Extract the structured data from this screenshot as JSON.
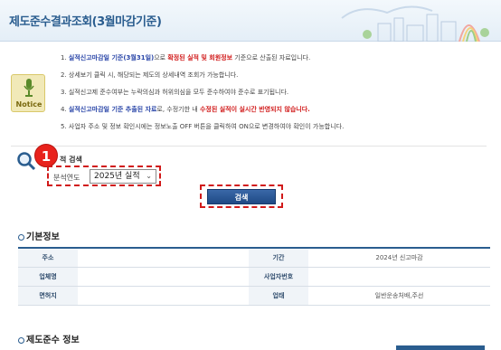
{
  "header": {
    "title": "제도준수결과조회(3월마감기준)"
  },
  "notice": {
    "badge_label": "Notice",
    "items": [
      {
        "num": "1.",
        "parts": [
          {
            "t": "실적신고마감일 기준(3월31일)",
            "s": "b"
          },
          {
            "t": "으로 ",
            "s": ""
          },
          {
            "t": "확정된 실적 및 회원정보",
            "s": "r"
          },
          {
            "t": " 기준으로 산출된 자료입니다.",
            "s": ""
          }
        ]
      },
      {
        "num": "2.",
        "parts": [
          {
            "t": "상세보기 클릭 시, 해당되는 제도의 상세내역 조회가 가능합니다.",
            "s": ""
          }
        ]
      },
      {
        "num": "3.",
        "parts": [
          {
            "t": "실적신고제 준수여부는 누락의심과 허위의심을 모두 준수하여야 준수로 표기됩니다.",
            "s": ""
          }
        ]
      },
      {
        "num": "4.",
        "parts": [
          {
            "t": "실적신고마감일 기준 추출된 자료",
            "s": "b"
          },
          {
            "t": "로, 수정기한 내 ",
            "s": ""
          },
          {
            "t": "수정된 실적이 실시간 반영되지 않습니다.",
            "s": "r"
          }
        ]
      },
      {
        "num": "5.",
        "parts": [
          {
            "t": "사업자 주소 및 정보 확인시에는 정보노출 OFF 버튼을 클릭하여 ON으로 변경하여야 확인이 가능합니다.",
            "s": ""
          }
        ]
      }
    ]
  },
  "search": {
    "step_number": "1",
    "heading": "적 검색",
    "year_label": "분석연도",
    "year_value": "2025년 실적",
    "button_label": "검색"
  },
  "basic_info": {
    "title": "기본정보",
    "rows": [
      {
        "label1": "주소",
        "value1": "",
        "label2": "기간",
        "value2": "2024년 신고마감"
      },
      {
        "label1": "업체명",
        "value1": "",
        "label2": "사업자번호",
        "value2": ""
      },
      {
        "label1": "면허지",
        "value1": "",
        "label2": "업태",
        "value2": "일반운송처배,주선"
      }
    ]
  },
  "compliance": {
    "title": "제도준수 정보"
  }
}
